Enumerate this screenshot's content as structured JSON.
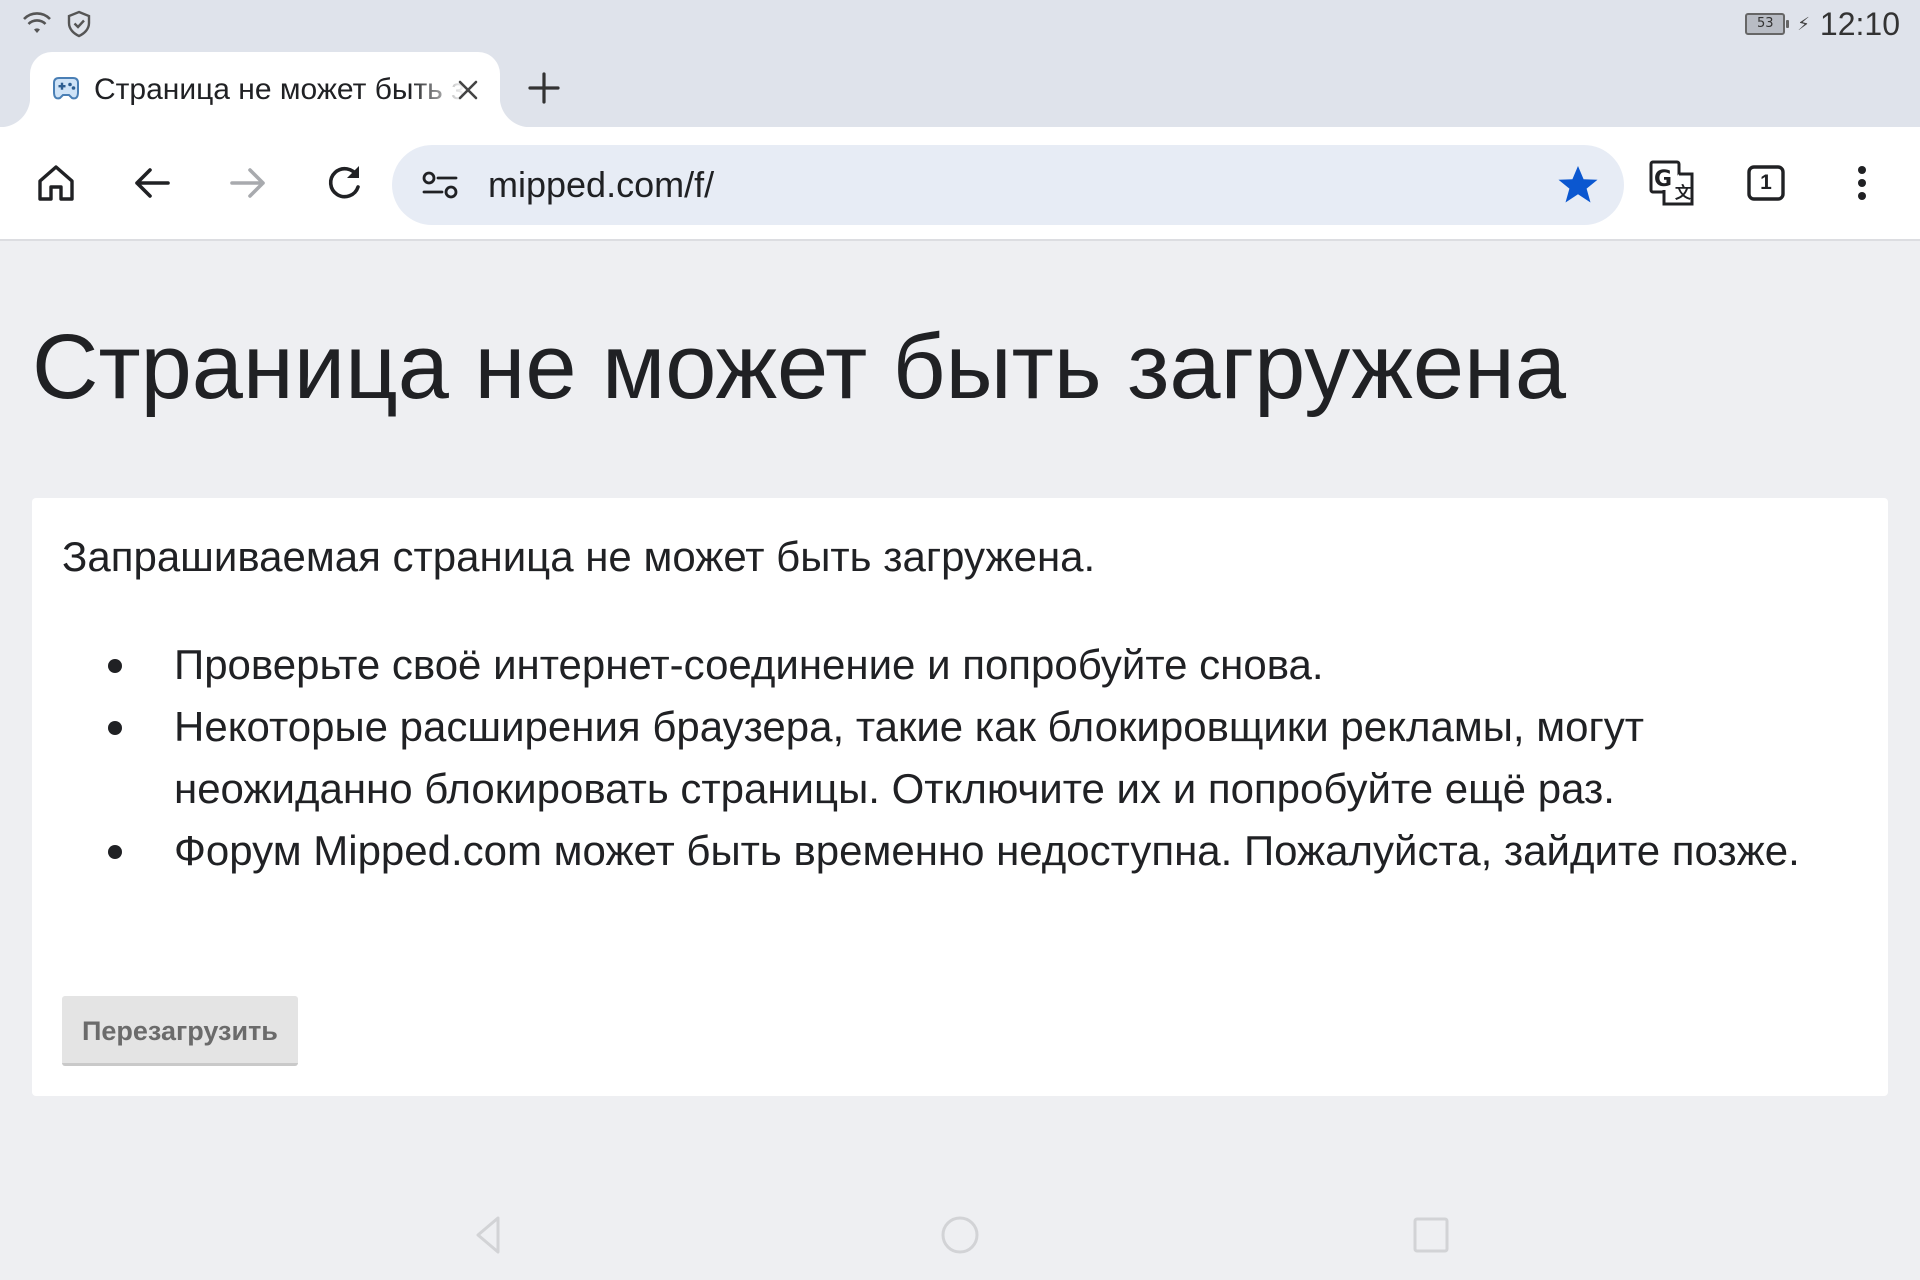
{
  "status_bar": {
    "time": "12:10",
    "battery_level": "53",
    "icons": [
      "wifi-icon",
      "shield-icon",
      "battery-icon",
      "charging-icon"
    ]
  },
  "tab": {
    "title": "Страница не может быть загружена",
    "favicon": "gamepad-favicon-icon",
    "close_icon": "close-icon",
    "new_tab_icon": "plus-icon"
  },
  "toolbar": {
    "url": "mipped.com/f/",
    "tabs_count": "1",
    "icons": [
      "home-icon",
      "back-arrow-icon",
      "forward-arrow-icon",
      "reload-icon",
      "site-settings-icon",
      "bookmark-star-icon",
      "translate-icon",
      "tab-switcher-icon",
      "more-menu-icon"
    ],
    "star_color": "#0b57d0"
  },
  "page": {
    "heading": "Страница не может быть загружена",
    "intro": "Запрашиваемая страница не может быть загружена.",
    "tips": [
      "Проверьте своё интернет-соединение и попробуйте снова.",
      "Некоторые расширения браузера, такие как блокировщики рекламы, могут неожиданно блокировать страницы. Отключите их и попробуйте ещё раз.",
      "Форум Mipped.com может быть временно недоступна. Пожалуйста, зайдите позже."
    ],
    "reload_button": "Перезагрузить"
  },
  "navigation_bar": {
    "icons": [
      "nav-back-icon",
      "nav-home-icon",
      "nav-recents-icon"
    ]
  }
}
